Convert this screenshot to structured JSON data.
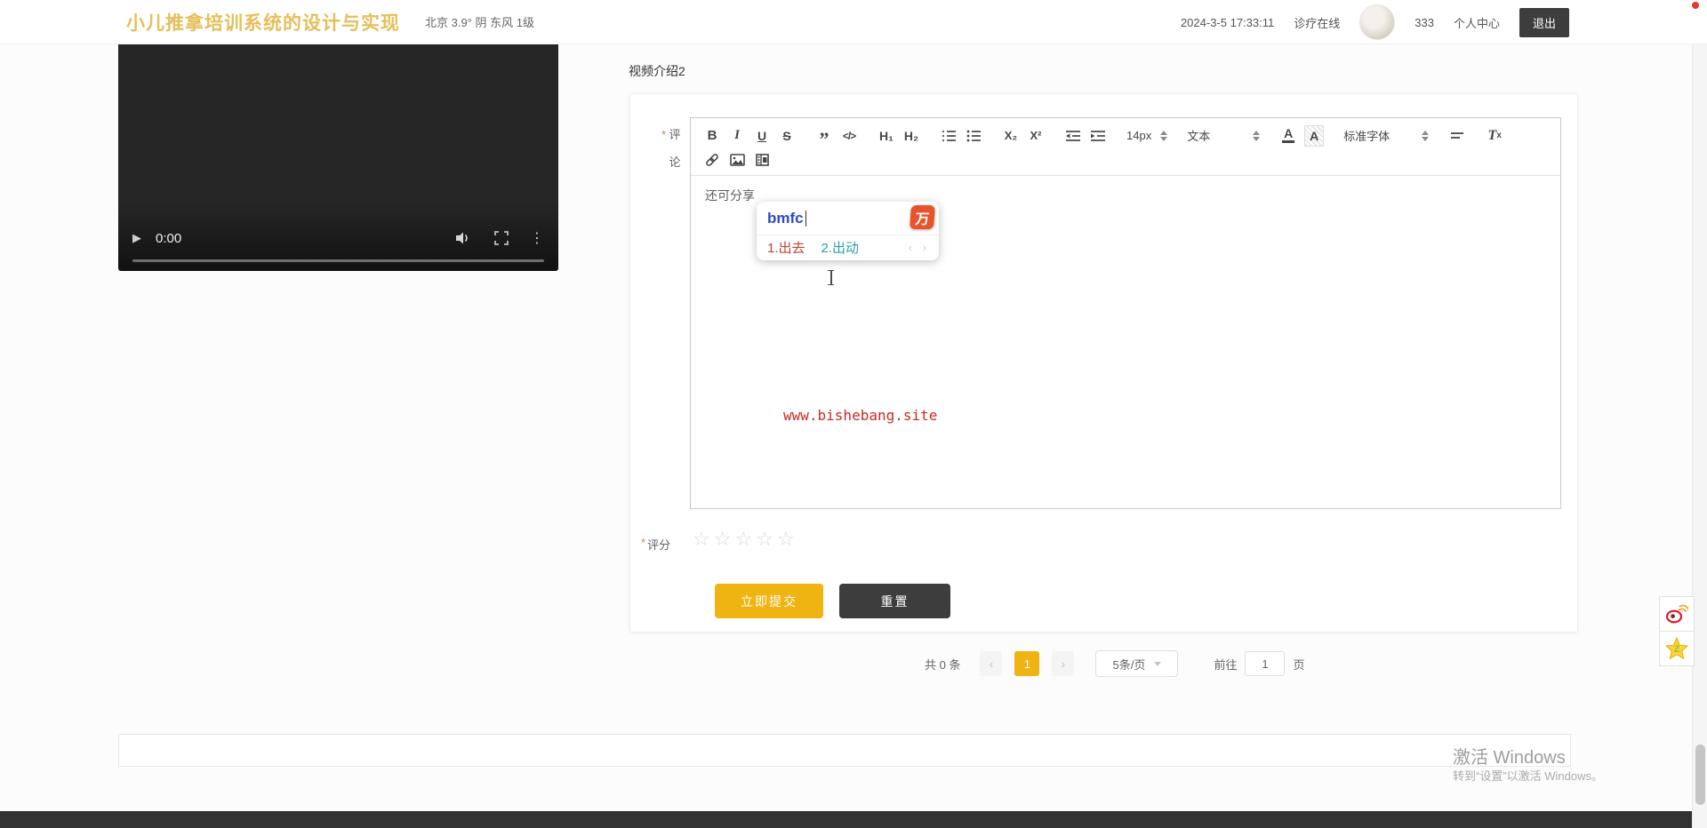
{
  "header": {
    "title": "小儿推拿培训系统的设计与实现",
    "weather": "北京  3.9°  阴  东风  1级",
    "datetime": "2024-3-5 17:33:11",
    "online_link": "诊疗在线",
    "username": "333",
    "personal_center": "个人中心",
    "logout": "退出"
  },
  "video": {
    "time": "0:00"
  },
  "section": {
    "video_intro": "视频介绍2"
  },
  "comment_form": {
    "required_mark": "*",
    "comment_label": "评论",
    "editor": {
      "content": "还可分享",
      "watermark": "www.bishebang.site",
      "toolbar": {
        "bold": "B",
        "italic": "I",
        "underline": "U",
        "strike": "S",
        "quote": "”",
        "code": "</>",
        "h1": "H₁",
        "h2": "H₂",
        "subscript": "X₂",
        "superscript": "X²",
        "font_size": "14px",
        "format": "文本",
        "color_a": "A",
        "bg_a": "A",
        "font_family": "标准字体",
        "clear_t": "T",
        "clear_x": "x"
      }
    },
    "rating_label": "评分",
    "star": "☆",
    "submit": "立即提交",
    "reset": "重置"
  },
  "ime": {
    "compose": "bmfc",
    "brand": "万",
    "candidate1": "1.出去",
    "candidate2": "2.出动",
    "nav": "‹ ›"
  },
  "pagination": {
    "total": "共 0 条",
    "prev": "‹",
    "page": "1",
    "next": "›",
    "page_size": "5条/页",
    "goto_label": "前往",
    "goto_value": "1",
    "page_unit": "页"
  },
  "windows_watermark": {
    "line1": "激活 Windows",
    "line2": "转到“设置”以激活 Windows。"
  },
  "icons": {
    "play": "▶",
    "dots": "⋮"
  },
  "colors": {
    "accent_yellow": "#F0B412",
    "dark_button": "#3D3D3D",
    "title_gold": "#E5BF5A",
    "watermark_red": "#CC2A26",
    "ime_blue": "#2B4ACB",
    "candidate1_red": "#C0462C",
    "candidate2_teal": "#2E9E9E",
    "ime_brand_orange": "#E8532B"
  }
}
